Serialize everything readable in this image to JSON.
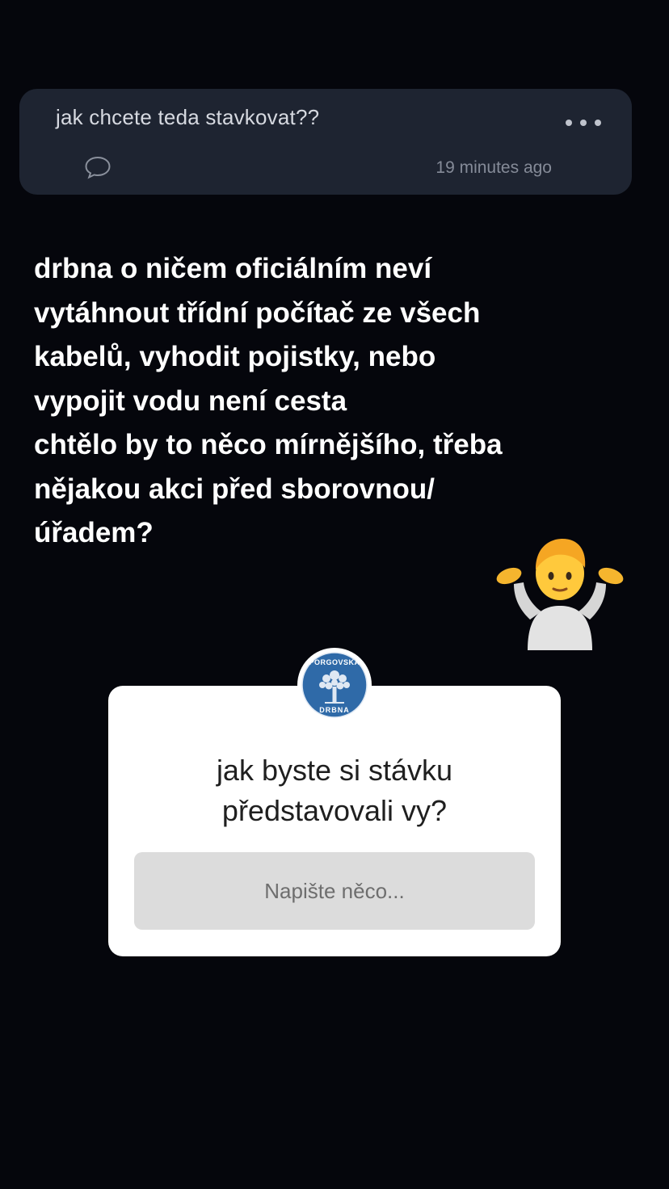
{
  "post": {
    "question": "jak chcete teda stavkovat??",
    "time": "19 minutes ago",
    "more_icon": "more-dots-icon",
    "comment_icon": "comment-bubble-icon"
  },
  "story_text": {
    "lines": [
      "drbna o ničem oficiálním neví",
      "vytáhnout třídní počítač ze všech",
      "kabelů, vyhodit pojistky, nebo",
      "vypojit vodu není cesta",
      "chtělo by to něco mírnějšího, třeba",
      "nějakou akci před sborovnou/",
      "úřadem?"
    ]
  },
  "sticker": {
    "emoji": "person-shrugging-emoji"
  },
  "question_box": {
    "avatar_text_top": "PORGOVSKÁ",
    "avatar_text_bottom": "DRBNA",
    "question_line1": "jak byste si stávku",
    "question_line2": "představovali vy?",
    "input_placeholder": "Napište něco..."
  },
  "colors": {
    "background": "#05060c",
    "card": "#1e2431",
    "avatar_blue": "#2f6aa8"
  }
}
